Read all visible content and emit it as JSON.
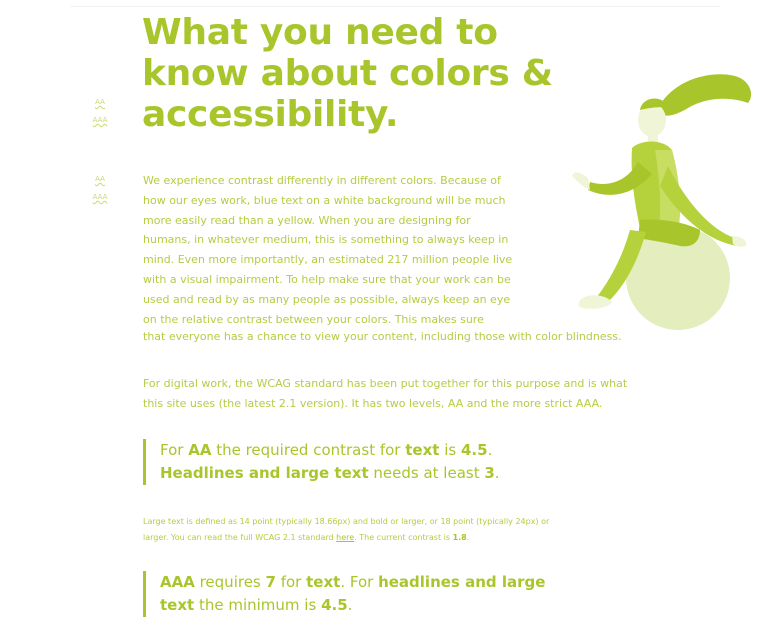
{
  "badges": {
    "first_aa": "AA",
    "first_aaa": "AAA",
    "second_aa": "AA",
    "second_aaa": "AAA"
  },
  "article": {
    "title": "What you need to know about colors & accessibility.",
    "intro": "We experience contrast differently in different colors. Because of how our eyes work, blue text on a white background will be much more easily read than a yellow. When you are designing for humans, in whatever medium, this is something to always keep in mind. Even more importantly, an estimated 217 million people live with a visual impairment. To help make sure that your work can be used and read by as many people as possible, always keep an eye on the relative contrast between your colors. This makes sure",
    "intro_last_line": "that everyone has a chance to view your content, including those with color blindness.",
    "wcag": "For digital work, the WCAG standard has been put together for this purpose and is what this site uses (the latest 2.1 version). It has two levels, AA and the more strict AAA."
  },
  "quote_aa": {
    "t1": "For ",
    "b1": "AA",
    "t2": " the required contrast for ",
    "b2": "text",
    "t3": " is ",
    "b3": "4.5",
    "t4": ".",
    "b4": "Headlines and large text",
    "t5": " needs at least ",
    "b5": "3",
    "t6": "."
  },
  "note": {
    "text1": "Large text is defined as 14 point (typically 18.66px) and bold or larger, or 18 point (typically 24px) or larger. You can read the full WCAG 2.1 standard ",
    "link": "here",
    "text2": ". The current contrast is ",
    "contrast": "1.8",
    "text3": "."
  },
  "quote_aaa": {
    "b1": "AAA",
    "t1": " requires ",
    "b2": "7",
    "t2": " for ",
    "b3": "text",
    "t3": ". For ",
    "b4": "headlines and large text",
    "t4": " the minimum is ",
    "b5": "4.5",
    "t5": "."
  },
  "colors": {
    "accent": "#a8c62c",
    "text": "#b4cd42",
    "light": "#e3edbd"
  },
  "illustration": "woman-sitting-on-ball"
}
